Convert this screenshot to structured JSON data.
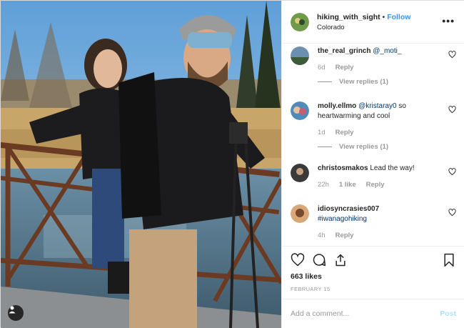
{
  "post": {
    "username": "hiking_with_sight",
    "separator": "•",
    "follow_label": "Follow",
    "location": "Colorado",
    "more_label": "•••"
  },
  "comments": [
    {
      "user": "the_real_grinch",
      "text": "",
      "mention": "@_moti_",
      "after": "",
      "age": "6d",
      "likes": "",
      "reply_label": "Reply",
      "view_replies": "View replies (1)"
    },
    {
      "user": "molly.ellmo",
      "text": "",
      "mention": "@kristaray0",
      "after": " so heartwarming and cool",
      "age": "1d",
      "likes": "",
      "reply_label": "Reply",
      "view_replies": "View replies (1)"
    },
    {
      "user": "christosmakos",
      "text": " Lead the way!",
      "mention": "",
      "after": "",
      "age": "22h",
      "likes": "1 like",
      "reply_label": "Reply",
      "view_replies": ""
    },
    {
      "user": "idiosyncrasies007",
      "text": "",
      "mention": "#iwanagohiking",
      "after": "",
      "age": "4h",
      "likes": "",
      "reply_label": "Reply",
      "view_replies": ""
    }
  ],
  "actions": {
    "like_icon": "heart-icon",
    "comment_icon": "comment-bubble-icon",
    "share_icon": "share-icon",
    "save_icon": "bookmark-icon"
  },
  "likes_count": "663 likes",
  "date": "FEBRUARY 15",
  "add_comment": {
    "placeholder": "Add a comment...",
    "post_label": "Post"
  },
  "colors": {
    "link": "#3897f0",
    "mention": "#003569",
    "muted": "#999999",
    "post_disabled": "#b2dffc"
  }
}
